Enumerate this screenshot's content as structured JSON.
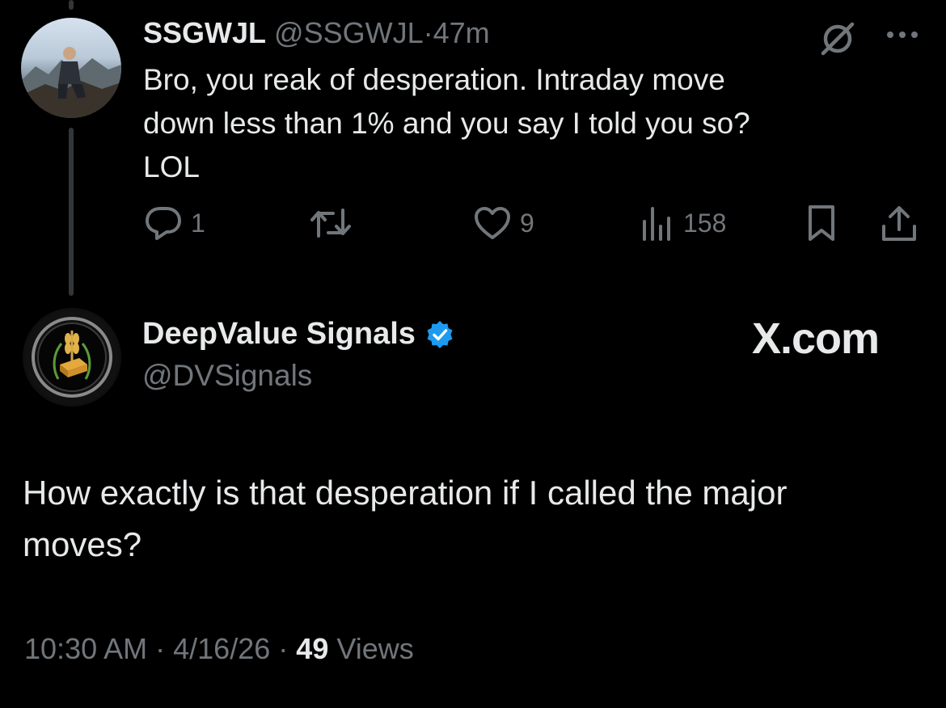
{
  "reply_tweet": {
    "author": {
      "name": "SSGWJL",
      "handle": "@SSGWJL",
      "separator": "·",
      "time_ago": "47m"
    },
    "text_lines": [
      "Bro, you reak of desperation. Intraday move",
      "down less than 1% and you say I told you so?",
      "LOL"
    ],
    "actions": {
      "reply_count": "1",
      "retweet_count": "",
      "like_count": "9",
      "view_count": "158"
    },
    "icons": [
      "grok-icon",
      "more-icon",
      "reply-icon",
      "retweet-icon",
      "like-icon",
      "views-icon",
      "bookmark-icon",
      "share-icon"
    ]
  },
  "main_tweet": {
    "author": {
      "name": "DeepValue Signals",
      "handle": "@DVSignals",
      "verified": true
    },
    "brand_label": "X.com",
    "text_lines": [
      "How exactly is that desperation if I called the major",
      "moves?"
    ],
    "meta": {
      "time": "10:30 AM",
      "separator": "·",
      "date": "4/16/26",
      "views_count": "49",
      "views_label": "Views"
    }
  },
  "colors": {
    "background": "#000000",
    "primary_text": "#e7e9ea",
    "secondary_text": "#71767b",
    "verified_blue": "#1d9bf0",
    "thread_line": "#333639"
  }
}
